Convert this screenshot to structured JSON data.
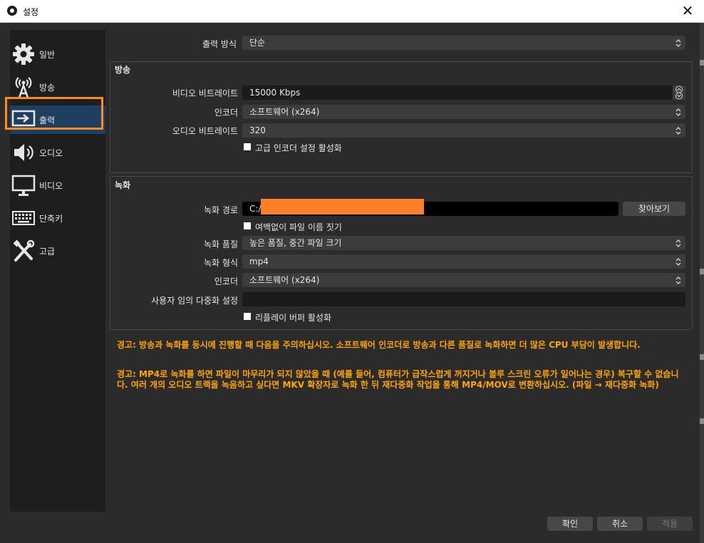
{
  "window": {
    "title": "설정",
    "close_glyph": "✕"
  },
  "sidebar": {
    "items": [
      {
        "label": "일반",
        "icon": "gear-icon"
      },
      {
        "label": "방송",
        "icon": "broadcast-icon"
      },
      {
        "label": "출력",
        "icon": "output-icon",
        "selected": true
      },
      {
        "label": "오디오",
        "icon": "speaker-icon"
      },
      {
        "label": "비디오",
        "icon": "monitor-icon"
      },
      {
        "label": "단축키",
        "icon": "keyboard-icon"
      },
      {
        "label": "고급",
        "icon": "tools-icon"
      }
    ]
  },
  "output_mode": {
    "label": "출력 방식",
    "value": "단순"
  },
  "streaming": {
    "title": "방송",
    "video_bitrate": {
      "label": "비디오 비트레이트",
      "value": "15000 Kbps"
    },
    "encoder": {
      "label": "인코더",
      "value": "소프트웨어 (x264)"
    },
    "audio_bitrate": {
      "label": "오디오 비트레이트",
      "value": "320"
    },
    "advanced_check": {
      "label": "고급 인코더 설정 활성화",
      "checked": false
    }
  },
  "recording": {
    "title": "녹화",
    "path": {
      "label": "녹화 경로",
      "value": "C:/",
      "browse": "찾아보기"
    },
    "no_space_check": {
      "label": "여백없이 파일 이름 짓기",
      "checked": false
    },
    "quality": {
      "label": "녹화 품질",
      "value": "높은 품질, 중간 파일 크기"
    },
    "format": {
      "label": "녹화 형식",
      "value": "mp4"
    },
    "encoder": {
      "label": "인코더",
      "value": "소프트웨어 (x264)"
    },
    "muxer": {
      "label": "사용자 임의 다중화 설정",
      "value": ""
    },
    "replay_check": {
      "label": "리플레이 버퍼 활성화",
      "checked": false
    }
  },
  "warnings": [
    "경고: 방송과 녹화를 동시에 진행할 때 다음을 주의하십시오. 소프트웨어 인코더로 방송과 다른 품질로 녹화하면 더 많은 CPU 부담이 발생합니다.",
    "경고: MP4로 녹화를 하면 파일이 마무리가 되지 않았을 때 (예를 들어, 컴퓨터가 급작스럽게 꺼지거나 블루 스크린 오류가 일어나는 경우) 복구할 수 없습니다. 여러 개의 오디오 트랙을 녹음하고 싶다면 MKV 확장자로 녹화 한 뒤 재다중화 작업을 통해 MP4/MOV로 변환하십시오. (파일 → 재다중화 녹화)"
  ],
  "buttons": {
    "ok": "확인",
    "cancel": "취소",
    "apply": "적용"
  },
  "colors": {
    "accent_highlight": "#ff8a1f",
    "warning_text": "#ffa500",
    "selected_bg": "#1e3f60"
  }
}
